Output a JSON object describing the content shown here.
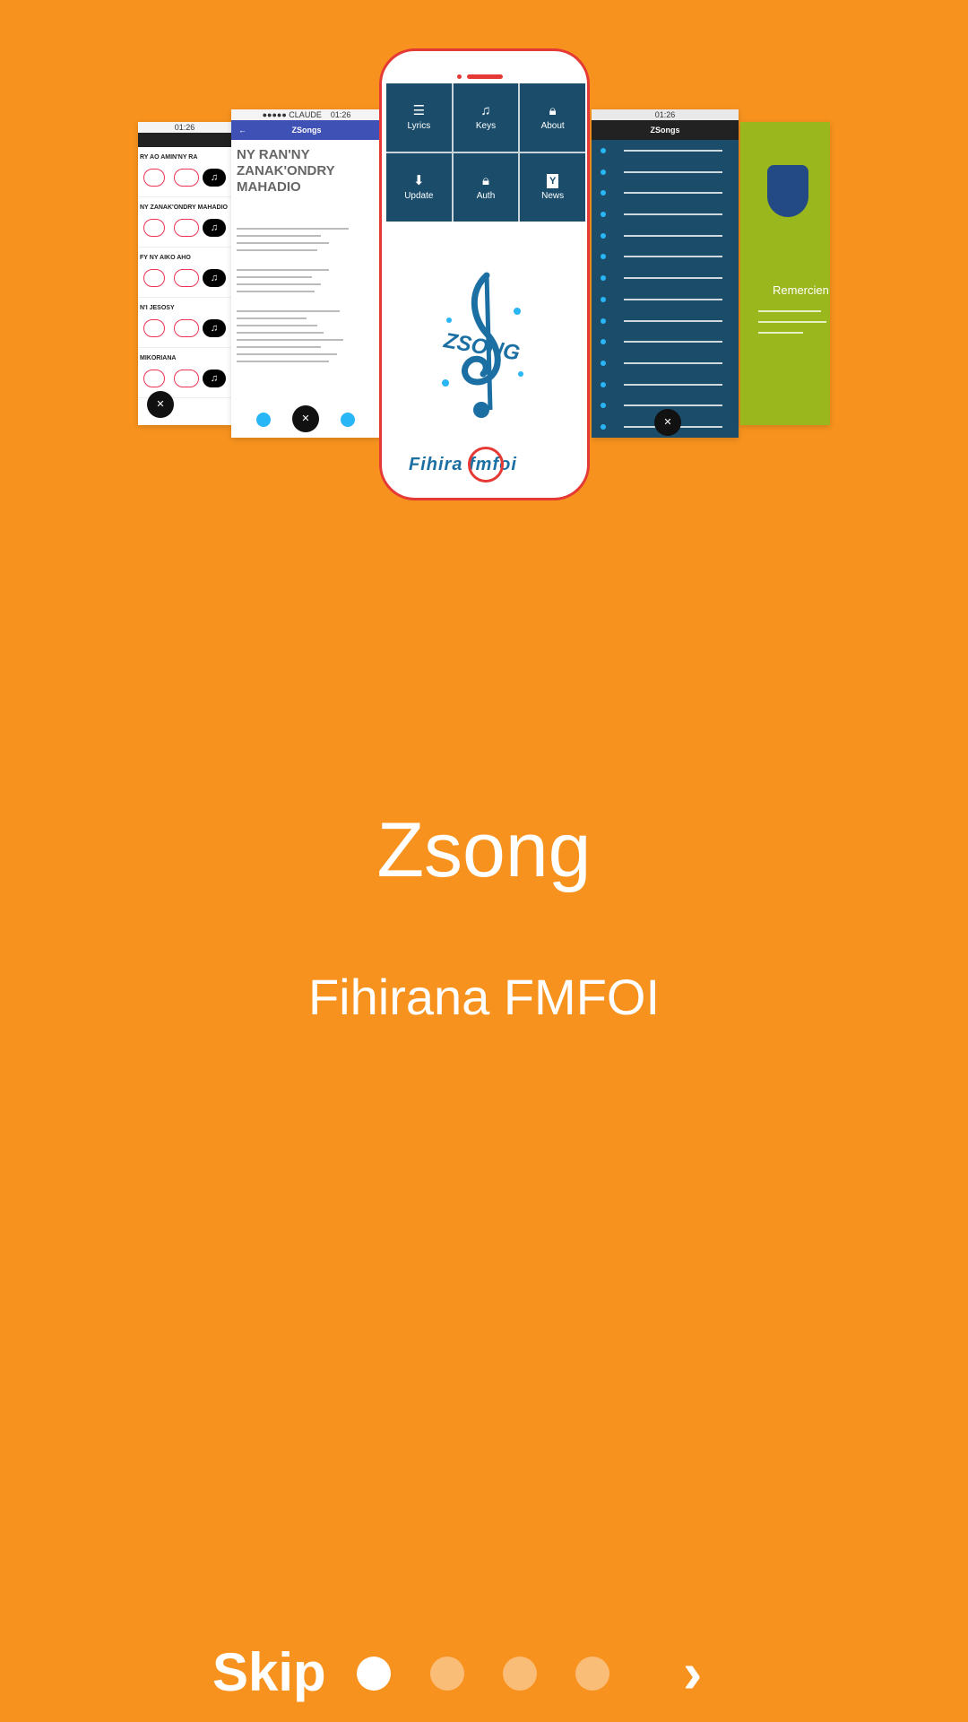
{
  "hero": {
    "phone_tiles": [
      {
        "label": "Lyrics",
        "icon": "list-icon"
      },
      {
        "label": "Keys",
        "icon": "music-note-icon"
      },
      {
        "label": "About",
        "icon": "lock-icon"
      },
      {
        "label": "Update",
        "icon": "download-icon"
      },
      {
        "label": "Auth",
        "icon": "lock-icon"
      },
      {
        "label": "News",
        "icon": "y-badge-icon"
      }
    ],
    "lyrics_card": {
      "carrier": "●●●●● CLAUDE",
      "time": "01:26",
      "header": "ZSongs",
      "song_title": "NY RAN'NY ZANAK'ONDRY MAHADIO"
    },
    "list_card": {
      "header": "ZSongs",
      "time": "01:26"
    },
    "green_card": {
      "text": "Remercien"
    },
    "logo_word": "Fihira fmfoi"
  },
  "colors": {
    "background": "#F7921E",
    "tile": "#1b4d6b",
    "accent_red": "#e53935"
  },
  "title": "Zsong",
  "subtitle": "Fihirana FMFOI",
  "nav": {
    "skip_label": "Skip",
    "next_label": "›",
    "page_count": 4,
    "current_page": 1
  }
}
